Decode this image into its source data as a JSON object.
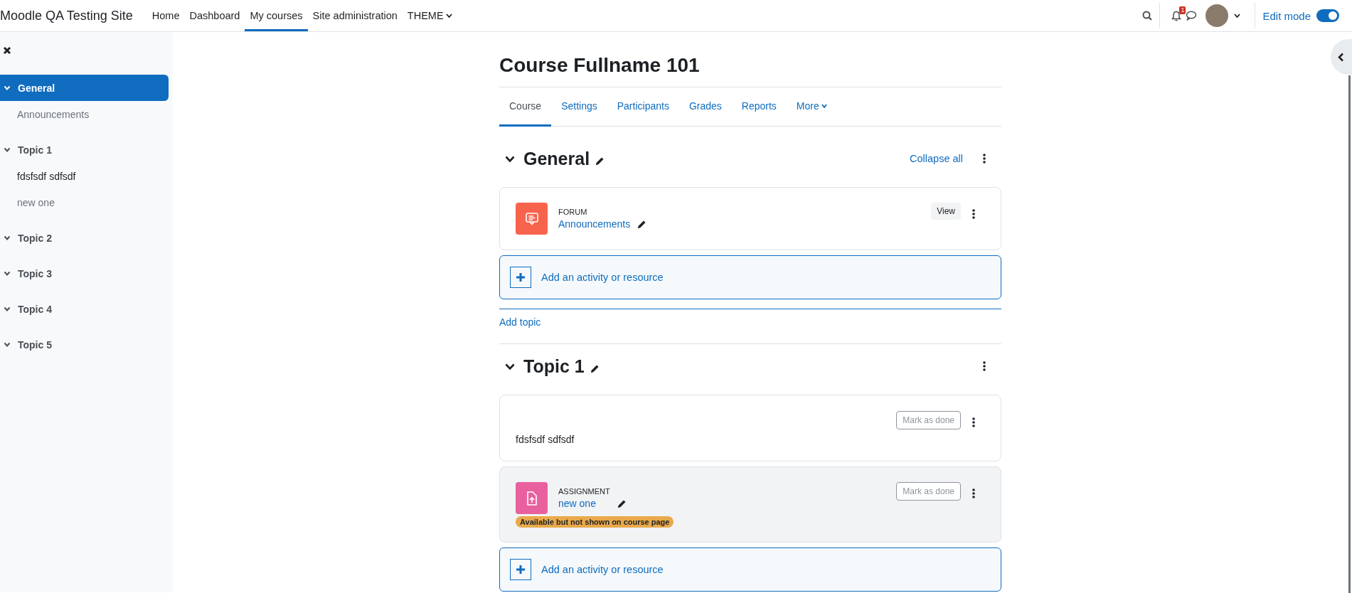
{
  "navbar": {
    "site_name": "Moodle QA Testing Site",
    "links": [
      {
        "label": "Home",
        "selected": false,
        "has_menu": false
      },
      {
        "label": "Dashboard",
        "selected": false,
        "has_menu": false
      },
      {
        "label": "My courses",
        "selected": true,
        "has_menu": false
      },
      {
        "label": "Site administration",
        "selected": false,
        "has_menu": false
      },
      {
        "label": "THEME",
        "selected": false,
        "has_menu": true
      }
    ],
    "notification_count": "1",
    "edit_mode": {
      "label": "Edit mode",
      "on": true
    }
  },
  "sidebar": {
    "items": [
      {
        "label": "General",
        "selected": true,
        "expanded": true,
        "children": [
          {
            "label": "Announcements",
            "dimmed": true
          }
        ]
      },
      {
        "label": "Topic 1",
        "selected": false,
        "expanded": true,
        "children": [
          {
            "label": "fdsfsdf sdfsdf",
            "dimmed": false
          },
          {
            "label": "new one",
            "dimmed": true
          }
        ]
      },
      {
        "label": "Topic 2",
        "selected": false,
        "expanded": true
      },
      {
        "label": "Topic 3",
        "selected": false,
        "expanded": true
      },
      {
        "label": "Topic 4",
        "selected": false,
        "expanded": true
      },
      {
        "label": "Topic 5",
        "selected": false,
        "expanded": true
      }
    ]
  },
  "course": {
    "title": "Course Fullname 101",
    "tabs": [
      {
        "label": "Course",
        "selected": true,
        "has_menu": false
      },
      {
        "label": "Settings",
        "selected": false,
        "has_menu": false
      },
      {
        "label": "Participants",
        "selected": false,
        "has_menu": false
      },
      {
        "label": "Grades",
        "selected": false,
        "has_menu": false
      },
      {
        "label": "Reports",
        "selected": false,
        "has_menu": false
      },
      {
        "label": "More",
        "selected": false,
        "has_menu": true
      }
    ],
    "sections": [
      {
        "title": "General",
        "expanded": true,
        "collapse_all": "Collapse all",
        "activities": [
          {
            "kind": "forum",
            "type_label": "FORUM",
            "name": "Announcements",
            "action": "View",
            "action_disabled": false,
            "stealth": false
          }
        ],
        "add_activity": "Add an activity or resource",
        "add_topic": "Add topic"
      },
      {
        "title": "Topic 1",
        "expanded": true,
        "activities": [
          {
            "kind": "text",
            "text": "fdsfsdf sdfsdf",
            "action": "Mark as done",
            "action_disabled": true,
            "stealth": false
          },
          {
            "kind": "assignment",
            "type_label": "ASSIGNMENT",
            "name": "new one",
            "action": "Mark as done",
            "action_disabled": true,
            "stealth": true,
            "badge": "Available but not shown on course page"
          }
        ],
        "add_activity": "Add an activity or resource"
      }
    ]
  }
}
